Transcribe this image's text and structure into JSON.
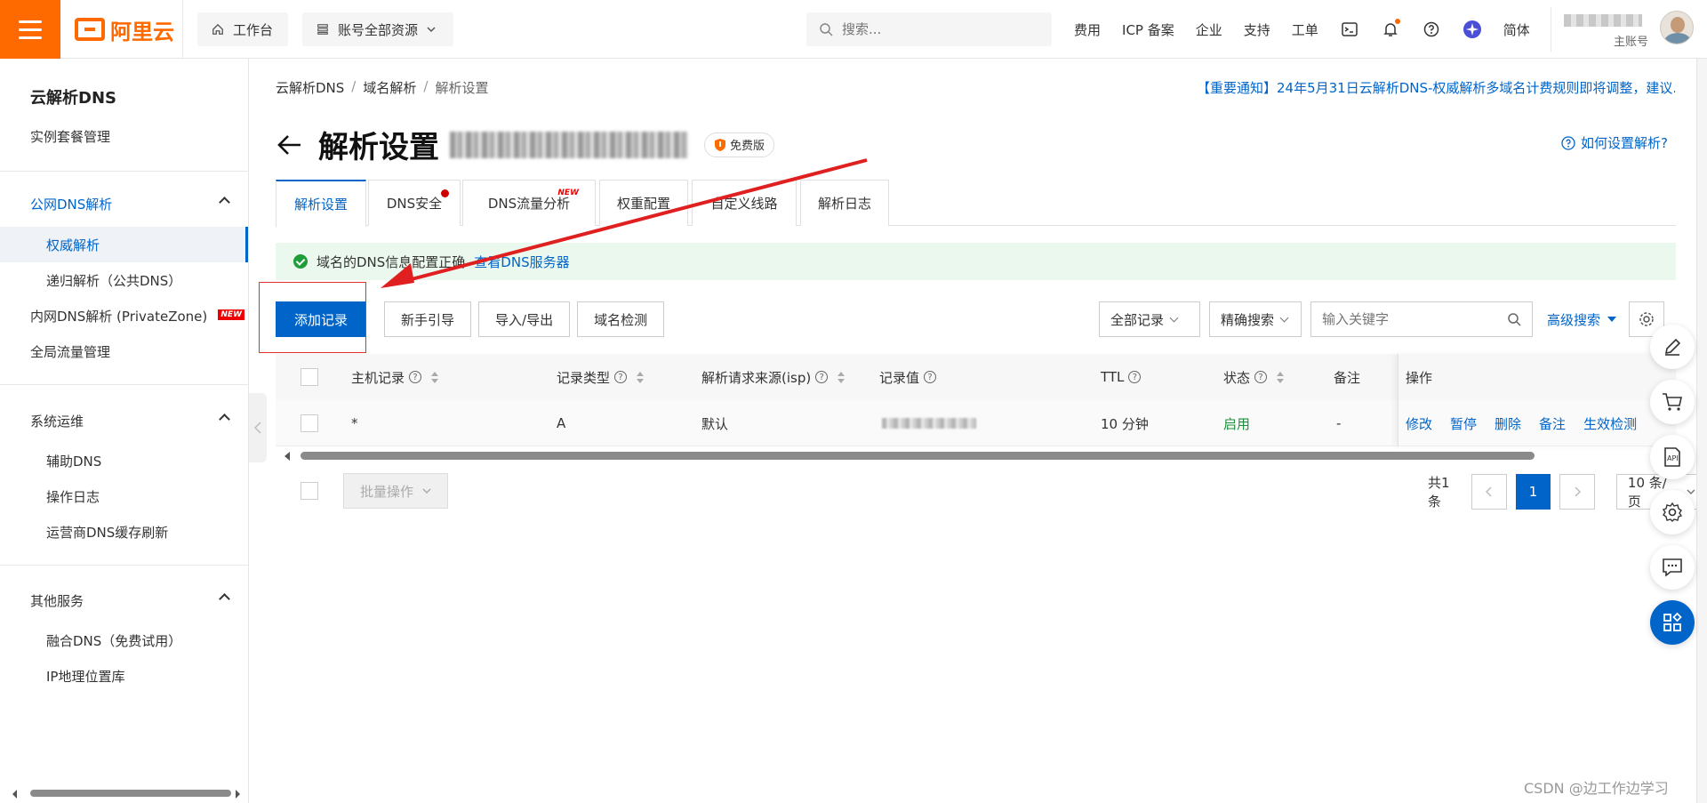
{
  "topbar": {
    "logo_text": "阿里云",
    "workbench": "工作台",
    "resources": "账号全部资源",
    "search_placeholder": "搜索...",
    "links": [
      "费用",
      "ICP 备案",
      "企业",
      "支持",
      "工单"
    ],
    "lang": "简体",
    "user_role": "主账号",
    "icons": [
      "terminal-icon",
      "bell-icon",
      "help-icon",
      "assistant-icon"
    ],
    "accent": "#ff6a00"
  },
  "sidebar": {
    "title": "云解析DNS",
    "instance": "实例套餐管理",
    "group_public": "公网DNS解析",
    "authoritative": "权威解析",
    "recursive": "递归解析（公共DNS）",
    "private_zone": "内网DNS解析 (PrivateZone)",
    "new_tag": "NEW",
    "global_traffic": "全局流量管理",
    "group_ops": "系统运维",
    "aux_dns": "辅助DNS",
    "op_log": "操作日志",
    "cache_refresh": "运营商DNS缓存刷新",
    "group_other": "其他服务",
    "fusion_dns": "融合DNS（免费试用）",
    "ip_geo": "IP地理位置库"
  },
  "breadcrumb": [
    "云解析DNS",
    "域名解析",
    "解析设置"
  ],
  "notice": "【重要通知】24年5月31日云解析DNS-权威解析多域名计费规则即将调整，建议...",
  "page": {
    "title": "解析设置",
    "badge": "免费版",
    "help": "如何设置解析?"
  },
  "tabs": [
    "解析设置",
    "DNS安全",
    "DNS流量分析",
    "权重配置",
    "自定义线路",
    "解析日志"
  ],
  "tab_new_tag": "NEW",
  "alert": {
    "text": "域名的DNS信息配置正确",
    "link": "查看DNS服务器"
  },
  "toolbar": {
    "add": "添加记录",
    "guide": "新手引导",
    "import_export": "导入/导出",
    "check": "域名检测"
  },
  "filters": {
    "all_records": "全部记录",
    "exact_search": "精确搜索",
    "keyword_placeholder": "输入关键字",
    "advanced": "高级搜索"
  },
  "table": {
    "headers": [
      "主机记录",
      "记录类型",
      "解析请求来源(isp)",
      "记录值",
      "TTL",
      "状态",
      "备注",
      "操作"
    ],
    "rows": [
      {
        "host": "*",
        "type": "A",
        "isp": "默认",
        "ttl": "10 分钟",
        "status": "启用",
        "remark": "-"
      }
    ],
    "actions": [
      "修改",
      "暂停",
      "删除",
      "备注",
      "生效检测"
    ]
  },
  "footer": {
    "batch": "批量操作",
    "total": "共1条",
    "page": "1",
    "page_size": "10 条/页"
  },
  "watermark": "CSDN @边工作边学习"
}
